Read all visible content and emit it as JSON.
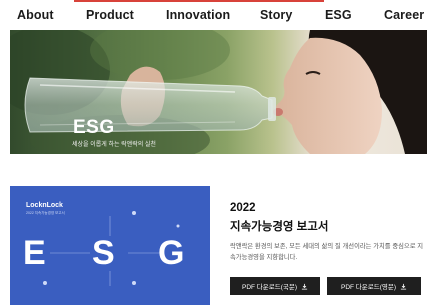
{
  "nav": {
    "items": [
      {
        "label": "About"
      },
      {
        "label": "Product"
      },
      {
        "label": "Innovation"
      },
      {
        "label": "Story"
      },
      {
        "label": "ESG"
      },
      {
        "label": "Career"
      }
    ]
  },
  "hero": {
    "title": "ESG",
    "subtitle": "세상을 이롭게 하는 락앤락의 실천"
  },
  "report": {
    "image": {
      "brand": "LocknLock",
      "brand_sub": "2022 지속가능경영 보고서",
      "letters": [
        "E",
        "S",
        "G"
      ]
    },
    "year": "2022",
    "title": "지속가능경영 보고서",
    "description": "락앤락은 환경의 보존, 모든 세대의 삶의 질 개선이라는 가치를 중심으로 지속가능경영을 지향합니다.",
    "buttons": [
      {
        "label": "PDF 다운로드(국문)",
        "icon": "download-icon"
      },
      {
        "label": "PDF 다운로드(영문)",
        "icon": "download-icon"
      }
    ]
  },
  "colors": {
    "accent_line": "#d8423a",
    "report_blue": "#3a5ec0",
    "button_bg": "#1f1f1f"
  }
}
